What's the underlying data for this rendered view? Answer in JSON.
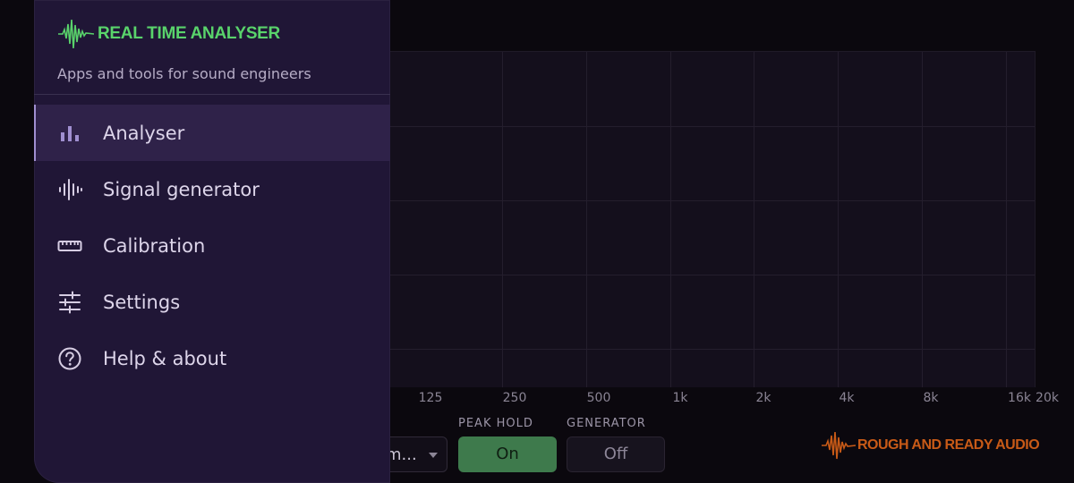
{
  "analyser": {
    "freq_labels": [
      "125",
      "250",
      "500",
      "1k",
      "2k",
      "4k",
      "8k",
      "16k",
      "20k"
    ],
    "controls": {
      "select_value": "m...",
      "peak_hold_label": "PEAK HOLD",
      "peak_hold_value": "On",
      "generator_label": "GENERATOR",
      "generator_value": "Off"
    },
    "brand_footer": "ROUGH AND READY AUDIO"
  },
  "drawer": {
    "app_title": "REAL TIME ANALYSER",
    "tagline": "Apps and tools for sound engineers",
    "items": [
      {
        "label": "Analyser",
        "icon": "bar-chart-icon",
        "active": true
      },
      {
        "label": "Signal generator",
        "icon": "waveform-icon",
        "active": false
      },
      {
        "label": "Calibration",
        "icon": "ruler-icon",
        "active": false
      },
      {
        "label": "Settings",
        "icon": "sliders-icon",
        "active": false
      },
      {
        "label": "Help & about",
        "icon": "help-circle-icon",
        "active": false
      }
    ]
  },
  "colors": {
    "accent": "#a08fd0",
    "logo_green": "#59d36b",
    "footer_orange": "#c85a17",
    "toggle_on": "#3e7a4c"
  }
}
